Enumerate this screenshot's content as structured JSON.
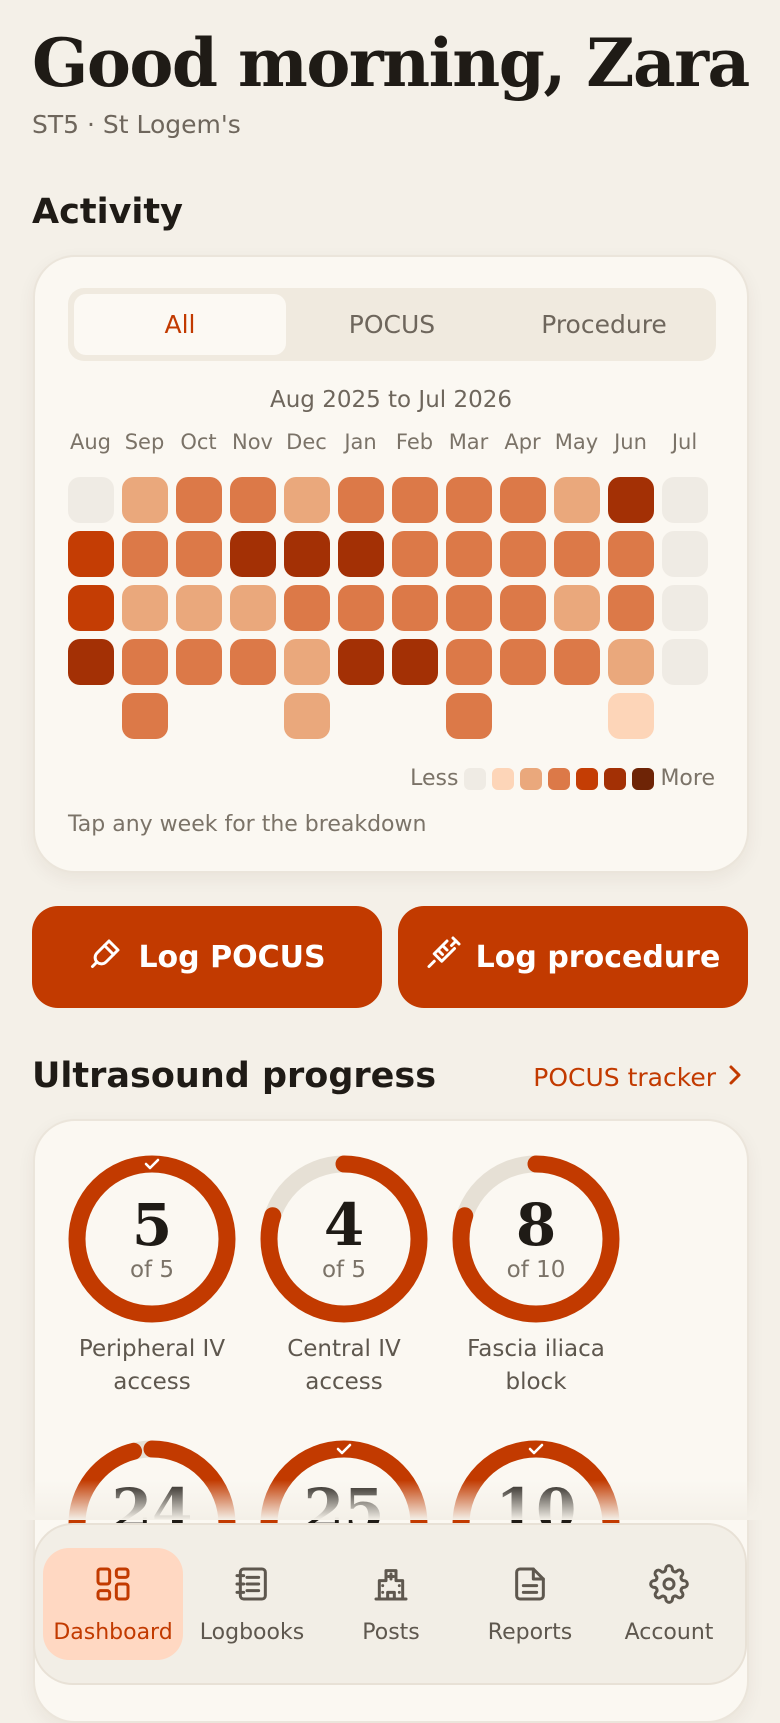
{
  "header": {
    "greeting": "Good morning, Zara",
    "subtitle": "ST5 · St Logem's"
  },
  "activity": {
    "title": "Activity",
    "tabs": [
      "All",
      "POCUS",
      "Procedure"
    ],
    "active_tab": 0,
    "range": "Aug 2025 to Jul 2026",
    "months": [
      "Aug",
      "Sep",
      "Oct",
      "Nov",
      "Dec",
      "Jan",
      "Feb",
      "Mar",
      "Apr",
      "May",
      "Jun",
      "Jul"
    ],
    "weeks": [
      [
        0,
        4,
        4,
        5
      ],
      [
        2,
        3,
        2,
        3,
        3
      ],
      [
        3,
        3,
        2,
        3
      ],
      [
        3,
        5,
        2,
        3
      ],
      [
        2,
        5,
        3,
        2,
        2
      ],
      [
        3,
        5,
        3,
        5
      ],
      [
        3,
        3,
        3,
        5
      ],
      [
        3,
        3,
        3,
        3,
        3
      ],
      [
        3,
        3,
        3,
        3
      ],
      [
        2,
        3,
        2,
        3
      ],
      [
        5,
        3,
        3,
        2,
        1
      ],
      [
        0,
        0,
        0,
        0
      ]
    ],
    "legend_less": "Less",
    "legend_more": "More",
    "legend_colors": [
      "#efebe4",
      "#fdd5b8",
      "#eaa87c",
      "#dc7948",
      "#c43d04",
      "#a33005",
      "#6e2406"
    ],
    "hint": "Tap any week for the breakdown"
  },
  "actions": {
    "log_pocus": "Log POCUS",
    "log_procedure": "Log procedure"
  },
  "progress": {
    "title": "Ultrasound progress",
    "link": "POCUS tracker",
    "items": [
      {
        "value": "5",
        "of": "of 5",
        "label": "Peripheral IV access",
        "fraction": 1.0,
        "complete": true
      },
      {
        "value": "4",
        "of": "of 5",
        "label": "Central IV access",
        "fraction": 0.8,
        "complete": false
      },
      {
        "value": "8",
        "of": "of 10",
        "label": "Fascia iliaca block",
        "fraction": 0.8,
        "complete": false
      },
      {
        "value": "24",
        "fraction": 0.96,
        "complete": false
      },
      {
        "value": "25",
        "fraction": 1.0,
        "complete": true
      },
      {
        "value": "10",
        "fraction": 1.0,
        "complete": true
      }
    ]
  },
  "nav": {
    "items": [
      "Dashboard",
      "Logbooks",
      "Posts",
      "Reports",
      "Account"
    ],
    "active": 0
  },
  "colors": {
    "accent": "#c23a00",
    "background": "#f4f0e8",
    "card": "#fbf8f2",
    "ring_track": "#e6e0d5"
  }
}
